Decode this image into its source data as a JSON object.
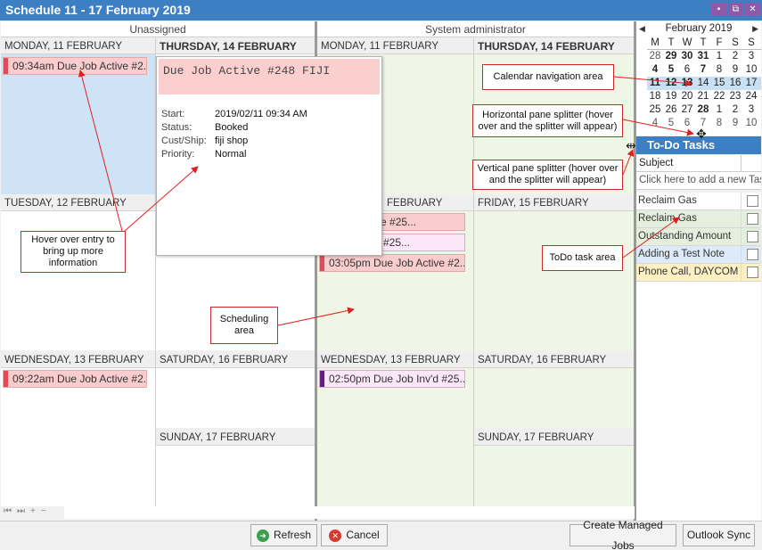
{
  "window": {
    "title": "Schedule   11 - 17 February 2019",
    "buttons": [
      "▪",
      "⧉",
      "✕"
    ]
  },
  "columns": {
    "unassigned": "Unassigned",
    "sysadmin": "System administrator"
  },
  "days": {
    "mon": "MONDAY, 11 FEBRUARY",
    "tue": "TUESDAY, 12 FEBRUARY",
    "wed": "WEDNESDAY, 13 FEBRUARY",
    "thu": "THURSDAY, 14 FEBRUARY",
    "fri": "FRIDAY, 15 FEBRUARY",
    "sat": "SATURDAY, 16 FEBRUARY",
    "sun": "SUNDAY, 17 FEBRUARY",
    "tue_partial": "FEBRUARY"
  },
  "appointments": {
    "un_mon": "09:34am Due Job Active #2...",
    "un_wed": "09:22am Due Job Active #2...",
    "sa_tue_1": "e Job Active #25...",
    "sa_tue_2": "e Job Inv'd #25...",
    "sa_tue_3": "03:05pm Due Job Active #2...",
    "sa_wed": "02:50pm Due Job Inv'd #25..."
  },
  "popup": {
    "title": "Due Job Active #248 FIJI",
    "rows": [
      {
        "label": "Start:",
        "value": "2019/02/11   09:34 AM"
      },
      {
        "label": "Status:",
        "value": "Booked"
      },
      {
        "label": "Cust/Ship:",
        "value": "fiji shop"
      },
      {
        "label": "Priority:",
        "value": "Normal"
      }
    ]
  },
  "callouts": {
    "hover": "Hover over entry to bring up more information",
    "scheduling": "Scheduling area",
    "calnav": "Calendar navigation area",
    "hsplit": "Horizontal pane splitter (hover over and the splitter will appear)",
    "vsplit": "Vertical pane splitter (hover over and the splitter will appear)",
    "todo": "ToDo task area"
  },
  "calendar": {
    "month": "February 2019",
    "prev": "◀",
    "next": "▶",
    "dow": [
      "M",
      "T",
      "W",
      "T",
      "F",
      "S",
      "S"
    ],
    "weeks": [
      [
        "28",
        "29",
        "30",
        "31",
        "1",
        "2",
        "3"
      ],
      [
        "4",
        "5",
        "6",
        "7",
        "8",
        "9",
        "10"
      ],
      [
        "11",
        "12",
        "13",
        "14",
        "15",
        "16",
        "17"
      ],
      [
        "18",
        "19",
        "20",
        "21",
        "22",
        "23",
        "24"
      ],
      [
        "25",
        "26",
        "27",
        "28",
        "1",
        "2",
        "3"
      ],
      [
        "4",
        "5",
        "6",
        "7",
        "8",
        "9",
        "10"
      ]
    ],
    "selected_week": 2,
    "accent": "#c9dff4"
  },
  "todo": {
    "title": "To-Do Tasks",
    "subject_header": "Subject",
    "add_placeholder": "Click here to add a new Task",
    "items": [
      {
        "label": "Reclaim Gas",
        "color": "#ffffff"
      },
      {
        "label": "Reclaim Gas",
        "color": "#e4efdd"
      },
      {
        "label": "Outstanding Amount",
        "color": "#e4efdd"
      },
      {
        "label": "Adding a Test Note",
        "color": "#ddebf8"
      },
      {
        "label": "Phone Call, DAYCOM",
        "color": "#fdf0c4"
      }
    ]
  },
  "pager": [
    "⏮",
    "⏭",
    "+",
    "−"
  ],
  "buttons": {
    "refresh": "Refresh",
    "cancel": "Cancel",
    "managed": "Create Managed Jobs",
    "outlook": "Outlook Sync"
  },
  "colors": {
    "titlebar": "#3c7fc3",
    "active_job": "#f9cdcd",
    "invoiced_job": "#fbe7f8",
    "callout_border": "#cc2a2a"
  }
}
